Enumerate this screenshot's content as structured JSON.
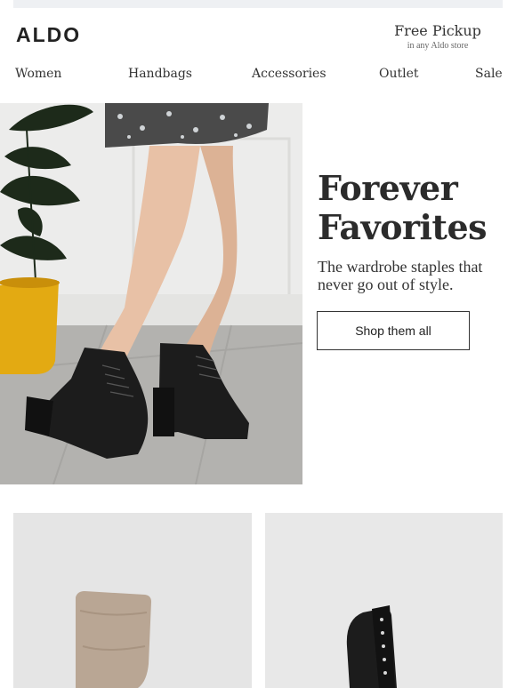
{
  "brand": {
    "name": "ALDO"
  },
  "pickup": {
    "title": "Free Pickup",
    "subtitle": "in any Aldo store"
  },
  "nav": {
    "items": [
      "Women",
      "Handbags",
      "Accessories",
      "Outlet",
      "Sale"
    ]
  },
  "hero": {
    "headline_line1": "Forever",
    "headline_line2": "Favorites",
    "subhead": "The wardrobe staples that never go out of style.",
    "cta_label": "Shop them all"
  },
  "colors": {
    "text": "#2a2a2a",
    "pot": "#e3aa12",
    "boot": "#1c1c1c",
    "suede": "#b9a694"
  }
}
